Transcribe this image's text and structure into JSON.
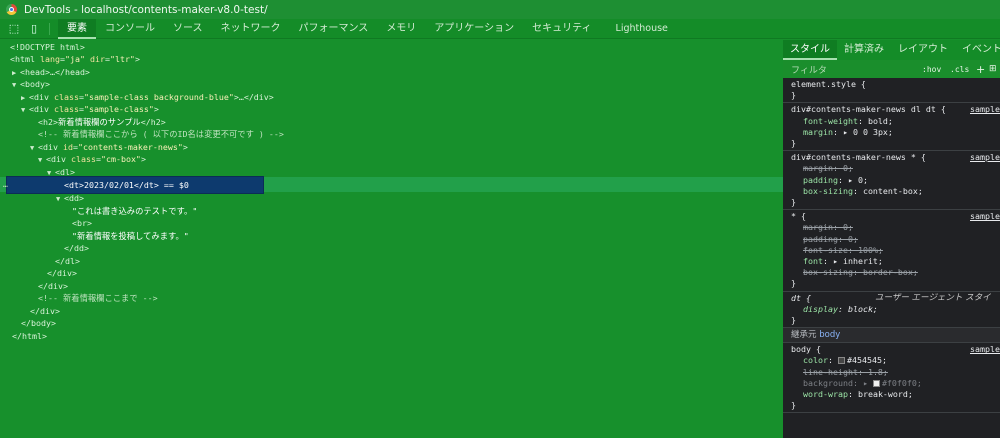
{
  "window": {
    "title": "DevTools - localhost/contents-maker-v8.0-test/"
  },
  "toolbar": {
    "inspect_icon": "inspect-element-icon",
    "device_icon": "device-toggle-icon"
  },
  "tabs": [
    {
      "label": "要素"
    },
    {
      "label": "コンソール"
    },
    {
      "label": "ソース"
    },
    {
      "label": "ネットワーク"
    },
    {
      "label": "パフォーマンス"
    },
    {
      "label": "メモリ"
    },
    {
      "label": "アプリケーション"
    },
    {
      "label": "セキュリティ"
    },
    {
      "label": "Lighthouse"
    }
  ],
  "dom": {
    "doctype": "<!DOCTYPE html>",
    "html_open_tag": "<html",
    "html_attr1_name": "lang",
    "html_attr1_value": "\"ja\"",
    "html_attr2_name": "dir",
    "html_attr2_value": "\"ltr\"",
    "head": "<head>…</head>",
    "body_open": "<body>",
    "div1_open": "<div",
    "div1_attr_name": "class",
    "div1_attr_value": "\"sample-class background-blue\"",
    "div1_tail": ">…</div>",
    "div2_open": "<div",
    "div2_attr_name": "class",
    "div2_attr_value": "\"sample-class\"",
    "h2_open": "<h2>",
    "h2_text": "新着情報欄のサンプル",
    "h2_close": "</h2>",
    "comment1": "<!-- 新着情報欄ここから ( 以下のID名は変更不可です ) -->",
    "div3_open": "<div",
    "div3_attr_name": "id",
    "div3_attr_value": "\"contents-maker-news\"",
    "div4_open": "<div",
    "div4_attr_name": "class",
    "div4_attr_value": "\"cm-box\"",
    "dl_open": "<dl>",
    "selected_dt": "<dt>2023/02/01</dt> == $0",
    "selected_dots": "…",
    "dd_open": "<dd>",
    "text1": "\"これは書き込みのテストです。\"",
    "br": "<br>",
    "text2": "\"新着情報を投稿してみます。\"",
    "dd_close": "</dd>",
    "dl_close": "</dl>",
    "div_close": "</div>",
    "comment2": "<!-- 新着情報欄ここまで -->",
    "body_close": "</body>",
    "html_close": "</html>",
    "gt": ">"
  },
  "styles_panel": {
    "tabs": [
      {
        "label": "スタイル"
      },
      {
        "label": "計算済み"
      },
      {
        "label": "レイアウト"
      },
      {
        "label": "イベントリ"
      }
    ],
    "filter_placeholder": "フィルタ",
    "hov": ":hov",
    "cls": ".cls",
    "plus": "+",
    "more": "⊞",
    "rules": {
      "element_style": {
        "selector": "element.style {",
        "close": "}"
      },
      "rule1": {
        "selector": "div#contents-maker-news dl dt {",
        "source": "sample",
        "decl1_name": "font-weight",
        "decl1_value": ": bold;",
        "decl2_name": "margin",
        "decl2_value": ": ▸ 0 0 3px;",
        "close": "}"
      },
      "rule2": {
        "selector": "div#contents-maker-news * {",
        "source": "sample",
        "decl1_name": "margin",
        "decl1_value": ": 0;",
        "decl2_name": "padding",
        "decl2_value": ": ▸ 0;",
        "decl3_name": "box-sizing",
        "decl3_value": ": content-box;",
        "close": "}"
      },
      "rule3": {
        "selector": "* {",
        "source": "sample",
        "decl1_name": "margin",
        "decl1_value": ": 0;",
        "decl2_name": "padding",
        "decl2_value": ": 0;",
        "decl3_name": "font-size",
        "decl3_value": ": 100%;",
        "decl4_name": "font",
        "decl4_value": ": ▸ inherit;",
        "decl5_name": "box-sizing",
        "decl5_value": ": border-box;",
        "close": "}"
      },
      "rule4": {
        "selector": "dt {",
        "ua_label": "ユーザー エージェント スタイ",
        "decl1_name": "display",
        "decl1_value": ": block;",
        "close": "}"
      },
      "inherited": {
        "label": "継承元",
        "link": "body"
      },
      "rule5": {
        "selector": "body {",
        "source": "sample",
        "decl1_name": "color",
        "decl1_value": "#454545;",
        "decl2_name": "line-height",
        "decl2_value": ": 1.8;",
        "decl3_name": "background",
        "decl3_value": "#f0f0f0;",
        "decl4_name": "word-wrap",
        "decl4_value": ": break-word;",
        "close": "}"
      }
    },
    "colors": {
      "color_swatch": "#454545",
      "background_swatch": "#f0f0f0"
    }
  }
}
